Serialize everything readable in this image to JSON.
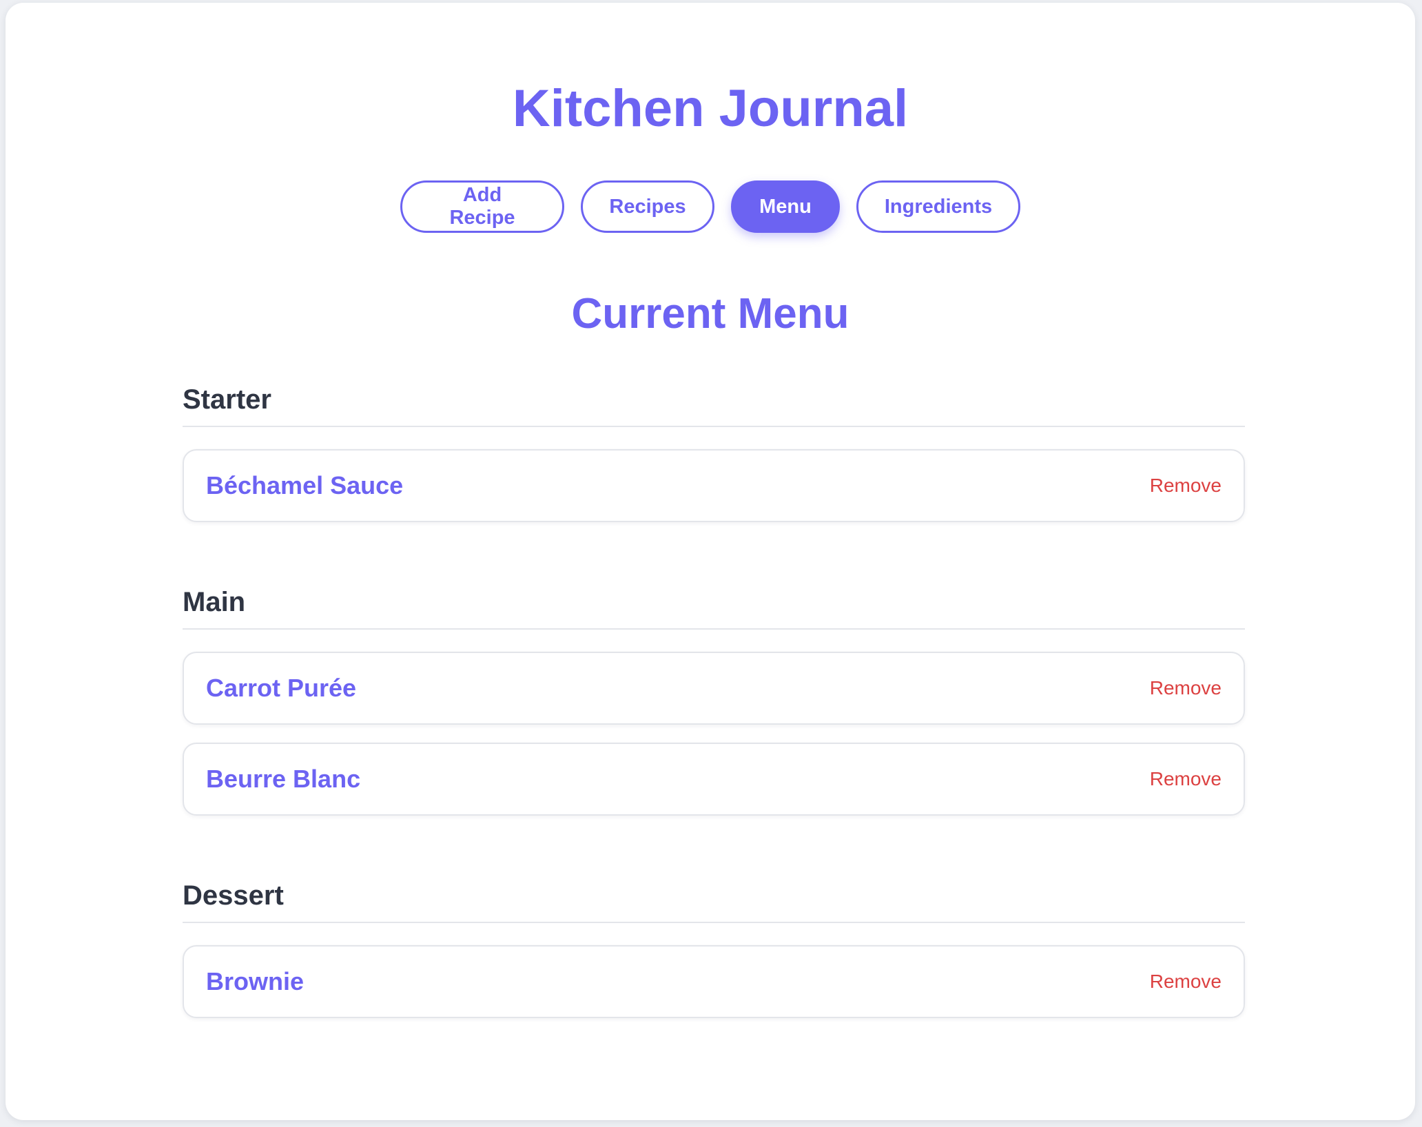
{
  "app": {
    "title": "Kitchen Journal"
  },
  "nav": {
    "items": [
      {
        "label": "Add Recipe",
        "active": false
      },
      {
        "label": "Recipes",
        "active": false
      },
      {
        "label": "Menu",
        "active": true
      },
      {
        "label": "Ingredients",
        "active": false
      }
    ]
  },
  "menu": {
    "title": "Current Menu",
    "courses": [
      {
        "name": "Starter",
        "items": [
          {
            "name": "Béchamel Sauce",
            "action": "Remove"
          }
        ]
      },
      {
        "name": "Main",
        "items": [
          {
            "name": "Carrot Purée",
            "action": "Remove"
          },
          {
            "name": "Beurre Blanc",
            "action": "Remove"
          }
        ]
      },
      {
        "name": "Dessert",
        "items": [
          {
            "name": "Brownie",
            "action": "Remove"
          }
        ]
      }
    ]
  },
  "colors": {
    "accent": "#6c63f2",
    "danger": "#dc4141",
    "heading": "#2f3543",
    "border": "#e3e5ea"
  }
}
